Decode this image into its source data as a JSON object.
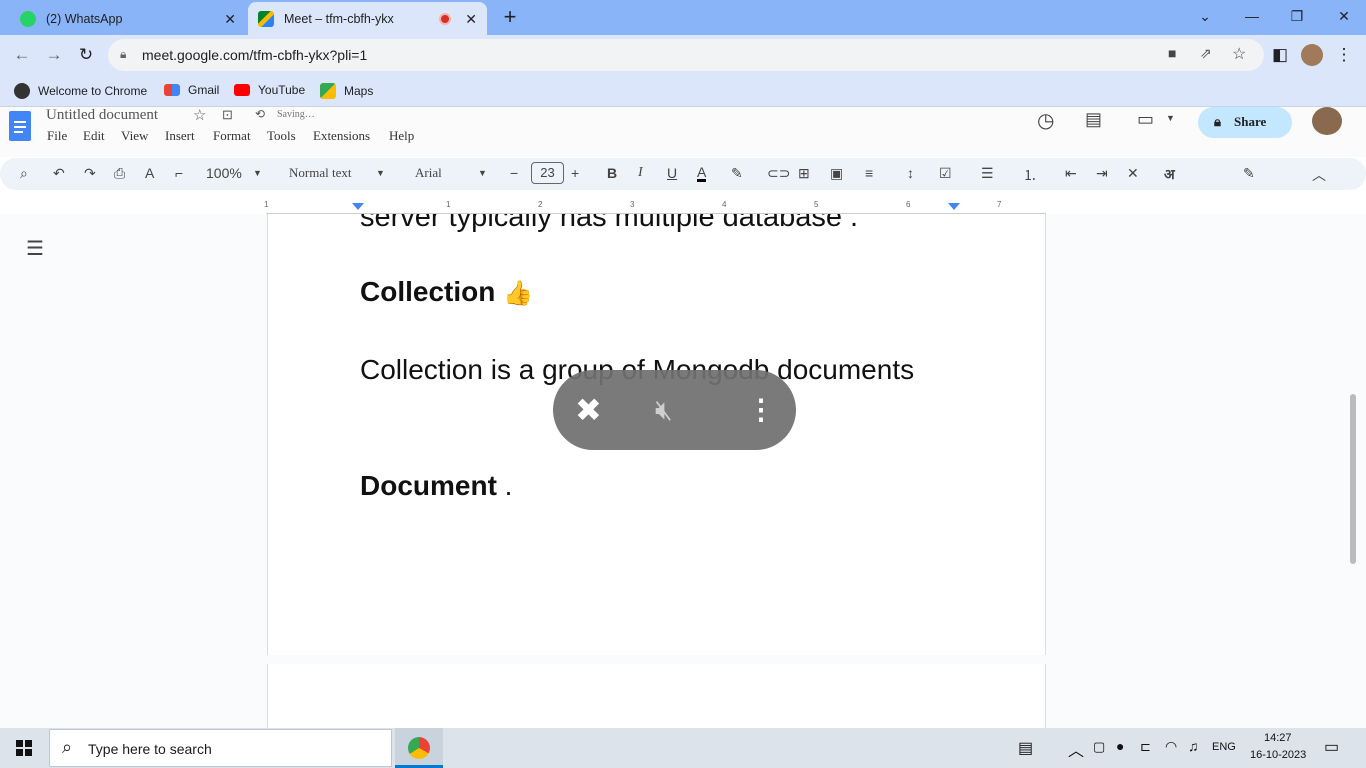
{
  "browser": {
    "tabs": [
      {
        "label": "(2) WhatsApp"
      },
      {
        "label": "Meet – tfm-cbfh-ykx"
      }
    ],
    "url": "meet.google.com/tfm-cbfh-ykx?pli=1",
    "bookmarks": [
      {
        "label": "Welcome to Chrome",
        "icon": "chrome-icon"
      },
      {
        "label": "Gmail",
        "icon": "gmail-icon"
      },
      {
        "label": "YouTube",
        "icon": "youtube-icon"
      },
      {
        "label": "Maps",
        "icon": "maps-icon"
      }
    ]
  },
  "docs": {
    "title": "Untitled document",
    "saving": "Saving…",
    "menus": [
      "File",
      "Edit",
      "View",
      "Insert",
      "Format",
      "Tools",
      "Extensions",
      "Help"
    ],
    "share_label": "Share",
    "zoom": "100%",
    "style": "Normal text",
    "font": "Arial",
    "font_size": "23",
    "ruler_numbers": [
      "1",
      "1",
      "2",
      "3",
      "4",
      "5",
      "6",
      "7"
    ],
    "lang_btn": "अ"
  },
  "document": {
    "line1": "server typically has multiple database .",
    "heading1": "Collection",
    "para1": "Collection is a group of Mongodb  documents",
    "heading2": "Document",
    "heading2_suffix": " ."
  },
  "taskbar": {
    "search_placeholder": "Type here to search",
    "lang": "ENG",
    "time": "14:27",
    "date": "16-10-2023"
  },
  "colors": {
    "chrome_tabstrip": "#8ab4f8",
    "chrome_toolbar": "#dbe6fb",
    "share_button": "#c2e7ff",
    "overlay": "#707070",
    "taskbar": "#dce3ea"
  }
}
